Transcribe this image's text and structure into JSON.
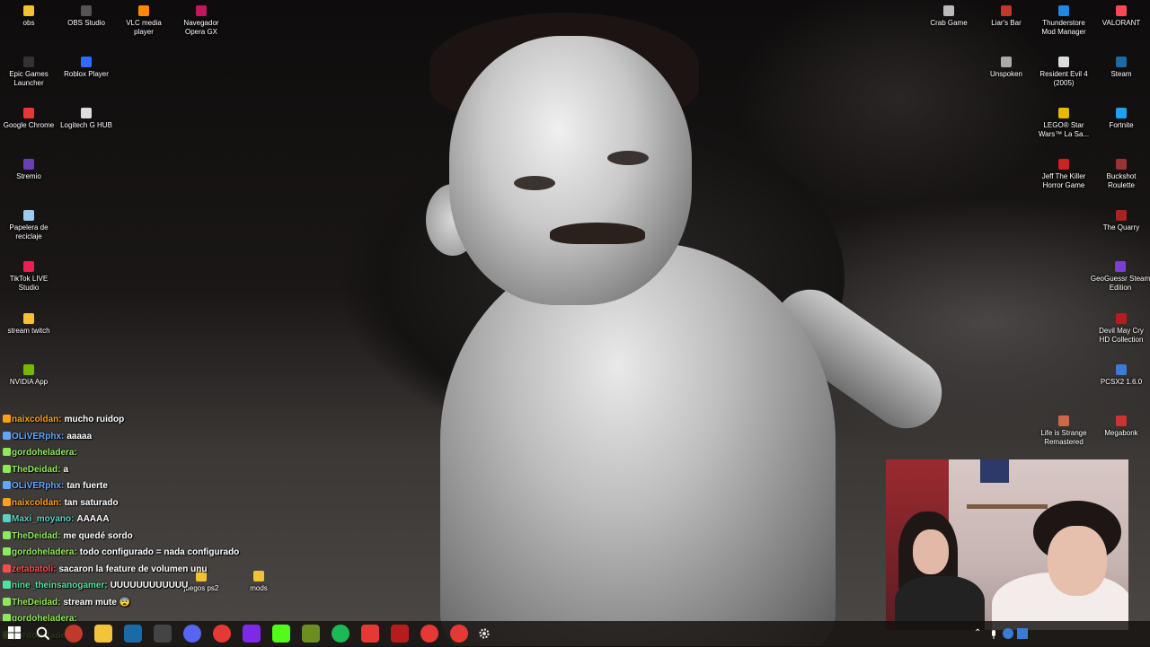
{
  "desktop": {
    "icons_left": [
      {
        "label": "obs",
        "icon": "folder-icon",
        "color": "#f1c232"
      },
      {
        "label": "OBS Studio",
        "icon": "obs-icon",
        "color": "#555555"
      },
      {
        "label": "VLC media player",
        "icon": "vlc-icon",
        "color": "#ff8800"
      },
      {
        "label": "Navegador Opera GX",
        "icon": "opera-gx-icon",
        "color": "#c2185b"
      },
      {
        "label": "Epic Games Launcher",
        "icon": "epic-games-icon",
        "color": "#333333"
      },
      {
        "label": "Roblox Player",
        "icon": "roblox-icon",
        "color": "#2f6bff"
      },
      {
        "label": "Google Chrome",
        "icon": "chrome-icon",
        "color": "#e53935"
      },
      {
        "label": "Logitech G HUB",
        "icon": "logitech-icon",
        "color": "#dddddd"
      },
      {
        "label": "Stremio",
        "icon": "stremio-icon",
        "color": "#6a3fb5"
      },
      {
        "label": "Papelera de reciclaje",
        "icon": "recycle-bin-icon",
        "color": "#9ecbf0"
      },
      {
        "label": "TikTok LIVE Studio",
        "icon": "tiktok-icon",
        "color": "#ee1d52"
      },
      {
        "label": "stream twitch",
        "icon": "folder-icon",
        "color": "#f1c232"
      },
      {
        "label": "NVIDIA App",
        "icon": "nvidia-icon",
        "color": "#76b900"
      },
      {
        "label": "juegos ps2",
        "icon": "folder-icon",
        "color": "#f1c232"
      },
      {
        "label": "mods",
        "icon": "folder-icon",
        "color": "#f1c232"
      }
    ],
    "icons_right": [
      {
        "label": "Crab Game",
        "icon": "crab-game-icon",
        "color": "#bbbbbb"
      },
      {
        "label": "Liar's Bar",
        "icon": "liars-bar-icon",
        "color": "#c0392b"
      },
      {
        "label": "Thunderstore Mod Manager",
        "icon": "thunderstore-icon",
        "color": "#1e88e5"
      },
      {
        "label": "VALORANT",
        "icon": "valorant-icon",
        "color": "#ff4655"
      },
      {
        "label": "Unspoken",
        "icon": "unspoken-icon",
        "color": "#aaaaaa"
      },
      {
        "label": "Resident Evil 4 (2005)",
        "icon": "resident-evil-icon",
        "color": "#dddddd"
      },
      {
        "label": "Steam",
        "icon": "steam-icon",
        "color": "#1b6aa5"
      },
      {
        "label": "LEGO® Star Wars™ La Sa...",
        "icon": "lego-star-wars-icon",
        "color": "#e6b800"
      },
      {
        "label": "Fortnite",
        "icon": "fortnite-icon",
        "color": "#1da1f2"
      },
      {
        "label": "Jeff The Killer Horror Game",
        "icon": "jeff-the-killer-icon",
        "color": "#cc2222"
      },
      {
        "label": "Buckshot Roulette",
        "icon": "buckshot-roulette-icon",
        "color": "#993333"
      },
      {
        "label": "The Quarry",
        "icon": "the-quarry-icon",
        "color": "#aa2222"
      },
      {
        "label": "GeoGuessr Steam Edition",
        "icon": "geoguessr-icon",
        "color": "#7b3fd1"
      },
      {
        "label": "Devil May Cry HD Collection",
        "icon": "devil-may-cry-icon",
        "color": "#b71c1c"
      },
      {
        "label": "PCSX2 1.6.0",
        "icon": "pcsx2-icon",
        "color": "#3a7bd5"
      },
      {
        "label": "Life is Strange Remastered",
        "icon": "life-is-strange-icon",
        "color": "#c96b4b"
      },
      {
        "label": "Megabonk",
        "icon": "megabonk-icon",
        "color": "#cc3333"
      }
    ]
  },
  "chat": {
    "messages": [
      {
        "user": "naixcoldan:",
        "text": "mucho ruidop",
        "color": "#ff9f1a"
      },
      {
        "user": "OLiVERphx:",
        "text": "aaaaa",
        "color": "#5fa8ff"
      },
      {
        "user": "gordoheladera:",
        "text": "",
        "color": "#8eea5a"
      },
      {
        "user": "TheDeidad:",
        "text": "a",
        "color": "#8eea5a"
      },
      {
        "user": "OLiVERphx:",
        "text": "tan fuerte",
        "color": "#5fa8ff"
      },
      {
        "user": "naixcoldan:",
        "text": "tan saturado",
        "color": "#ff9f1a"
      },
      {
        "user": "Maxi_moyano:",
        "text": "AAAAA",
        "color": "#5ad1c4"
      },
      {
        "user": "TheDeidad:",
        "text": "me quedé sordo",
        "color": "#8eea5a"
      },
      {
        "user": "gordoheladera:",
        "text": "todo configurado = nada configurado",
        "color": "#8eea5a"
      },
      {
        "user": "zetabatoli:",
        "text": "sacaron la feature de volumen unu",
        "color": "#ff4d4d"
      },
      {
        "user": "nine_theinsanogamer:",
        "text": "UUUUUUUUUUUU",
        "color": "#4fe3a0"
      },
      {
        "user": "TheDeidad:",
        "text": "stream mute 😨",
        "color": "#8eea5a"
      },
      {
        "user": "gordoheladera:",
        "text": "",
        "color": "#8eea5a"
      },
      {
        "user": "gordoheladera:",
        "text": "",
        "color": "#8eea5a"
      }
    ]
  },
  "taskbar": {
    "apps": [
      {
        "name": "file-explorer-icon",
        "color": "#f3c33a"
      },
      {
        "name": "steam-icon",
        "color": "#1b6aa5"
      },
      {
        "name": "obs-icon",
        "color": "#444444"
      },
      {
        "name": "discord-icon",
        "color": "#5865f2"
      },
      {
        "name": "chrome-icon",
        "color": "#e53935"
      },
      {
        "name": "canva-icon",
        "color": "#7d2ae8"
      },
      {
        "name": "kick-icon",
        "color": "#53fc18"
      },
      {
        "name": "minecraft-icon",
        "color": "#6b8e23"
      },
      {
        "name": "spotify-icon",
        "color": "#1db954"
      },
      {
        "name": "opera-gx-icon",
        "color": "#e53935"
      },
      {
        "name": "voicemeeter-icon",
        "color": "#b71c1c"
      },
      {
        "name": "chrome-icon",
        "color": "#e53935"
      },
      {
        "name": "chrome-icon",
        "color": "#e53935"
      }
    ]
  },
  "colors": {
    "taskbar_bg": "#141010",
    "chat_text": "#ffffff"
  }
}
